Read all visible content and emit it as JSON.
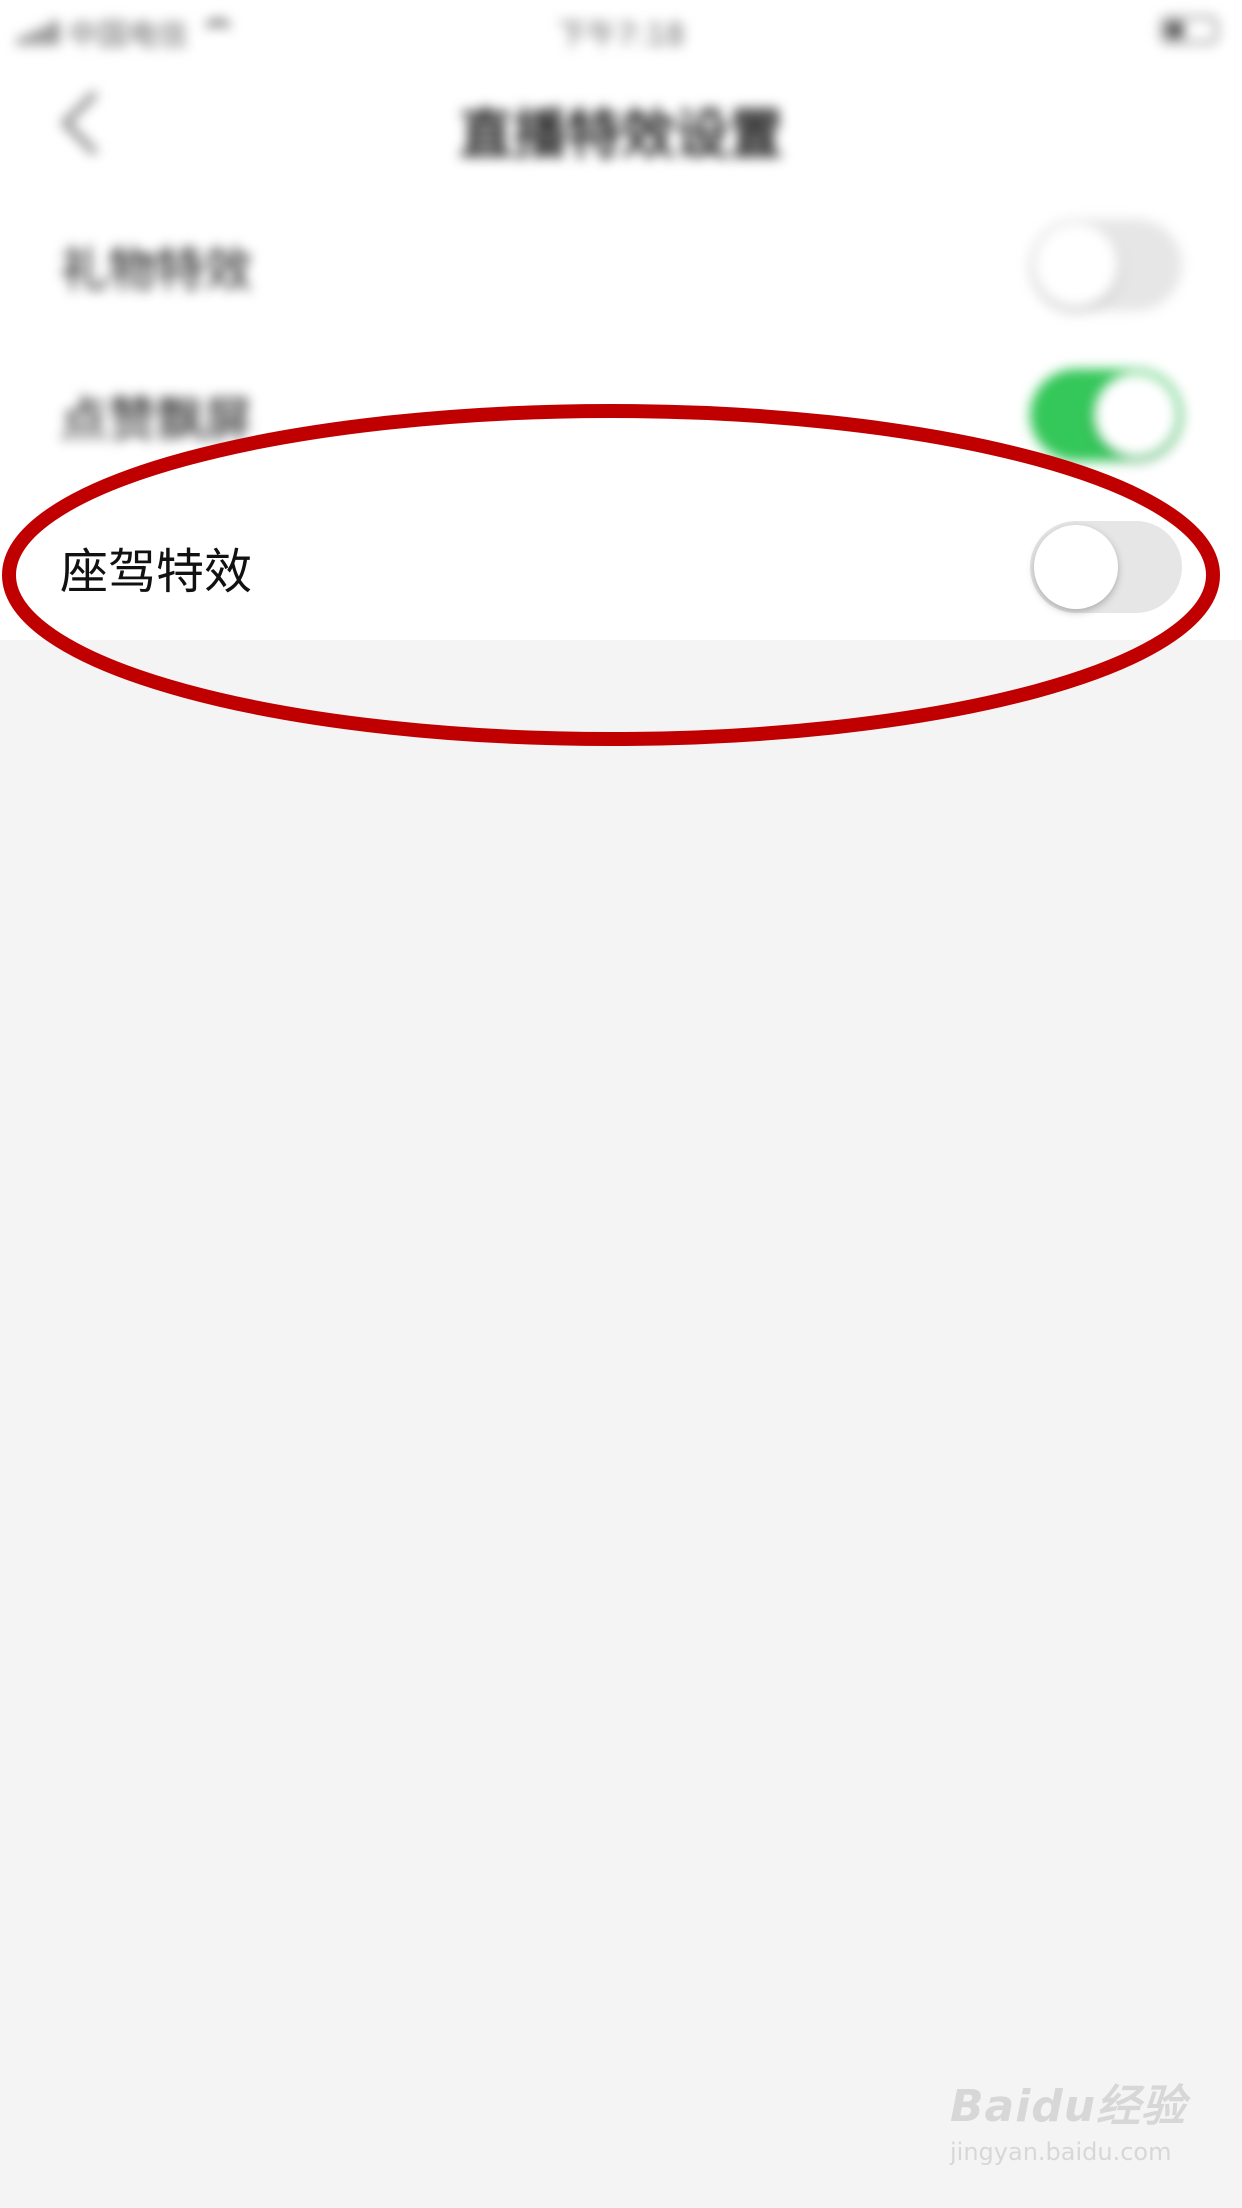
{
  "status_bar": {
    "carrier": "中国电信",
    "time": "下午7:18"
  },
  "nav": {
    "title": "直播特效设置",
    "back_icon": "chevron-left-icon"
  },
  "settings": [
    {
      "label": "礼物特效",
      "enabled": false
    },
    {
      "label": "点赞飘屏",
      "enabled": true
    },
    {
      "label": "座驾特效",
      "enabled": false
    }
  ],
  "colors": {
    "toggle_on": "#34c759",
    "toggle_off": "#e6e6e6",
    "annotation": "#c00000"
  },
  "watermark": {
    "logo": "Baidu经验",
    "url": "jingyan.baidu.com"
  }
}
